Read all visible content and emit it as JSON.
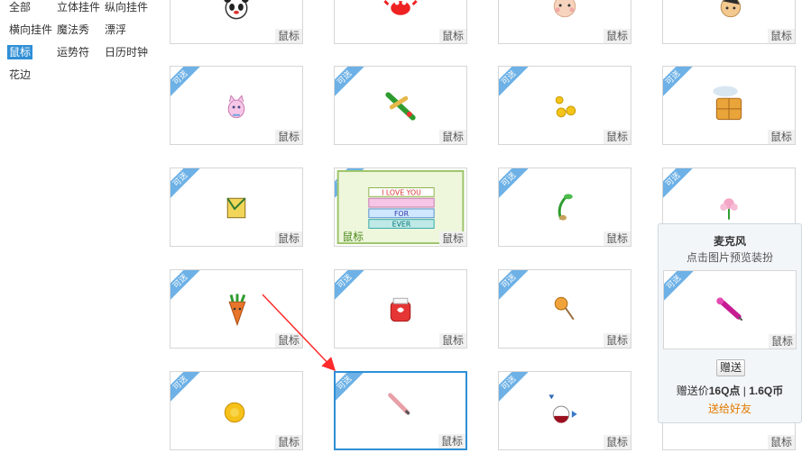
{
  "categories": [
    {
      "label": "全部",
      "active": false
    },
    {
      "label": "立体挂件",
      "active": false
    },
    {
      "label": "纵向挂件",
      "active": false
    },
    {
      "label": "横向挂件",
      "active": false
    },
    {
      "label": "魔法秀",
      "active": false
    },
    {
      "label": "漂浮",
      "active": false
    },
    {
      "label": "鼠标",
      "active": true
    },
    {
      "label": "运势符",
      "active": false
    },
    {
      "label": "日历时钟",
      "active": false
    },
    {
      "label": "花边",
      "active": false
    }
  ],
  "cards": [
    {
      "tag": "鼠标",
      "ribbon": "",
      "icon": "panda-icon"
    },
    {
      "tag": "鼠标",
      "ribbon": "",
      "icon": "crab-icon"
    },
    {
      "tag": "鼠标",
      "ribbon": "",
      "icon": "baby-face-icon"
    },
    {
      "tag": "鼠标",
      "ribbon": "",
      "icon": "bee-face-icon"
    },
    {
      "tag": "鼠标",
      "ribbon": "可送",
      "icon": "pink-cat-icon"
    },
    {
      "tag": "鼠标",
      "ribbon": "可送",
      "icon": "green-pencil-icon"
    },
    {
      "tag": "鼠标",
      "ribbon": "可送",
      "icon": "gold-coins-icon"
    },
    {
      "tag": "鼠标",
      "ribbon": "可送",
      "icon": "gift-basket-icon"
    },
    {
      "tag": "鼠标",
      "ribbon": "可送",
      "icon": "yellow-flower-cursor-icon"
    },
    {
      "tag": "鼠标",
      "ribbon": "可送",
      "icon": "i-love-you-banner-icon"
    },
    {
      "tag": "鼠标",
      "ribbon": "可送",
      "icon": "sprout-icon"
    },
    {
      "tag": "鼠标",
      "ribbon": "可送",
      "icon": "pink-flower-icon"
    },
    {
      "tag": "鼠标",
      "ribbon": "可送",
      "icon": "carrot-icon"
    },
    {
      "tag": "鼠标",
      "ribbon": "可送",
      "icon": "red-jar-icon"
    },
    {
      "tag": "鼠标",
      "ribbon": "可送",
      "icon": "lollipop-icon"
    },
    {
      "tag": "鼠标",
      "ribbon": "可送",
      "icon": "sunflower-icon"
    },
    {
      "tag": "鼠标",
      "ribbon": "可送",
      "icon": "pencil-icon"
    },
    {
      "tag": "鼠标",
      "ribbon": "可送",
      "icon": "wine-glass-icon"
    },
    {
      "tag": "鼠标",
      "ribbon": "",
      "icon": "hidden-card"
    }
  ],
  "banner_text": [
    "I LOVE YOU",
    "FOR",
    "EVER"
  ],
  "banner_tag": "鼠标",
  "tooltip": {
    "name": "麦克风",
    "hint": "点击图片预览装扮",
    "ribbon": "可送",
    "tag": "鼠标",
    "gift_label": "赠送",
    "price_prefix": "赠送价",
    "price_points": "16Q点",
    "price_sep": "|",
    "price_coins": "1.6Q币",
    "more": "送给好友",
    "icon": "microphone-icon"
  },
  "colors": {
    "accent": "#2f8fd6",
    "ribbon": "#6db1e6",
    "arrow": "#ff2a2a"
  }
}
